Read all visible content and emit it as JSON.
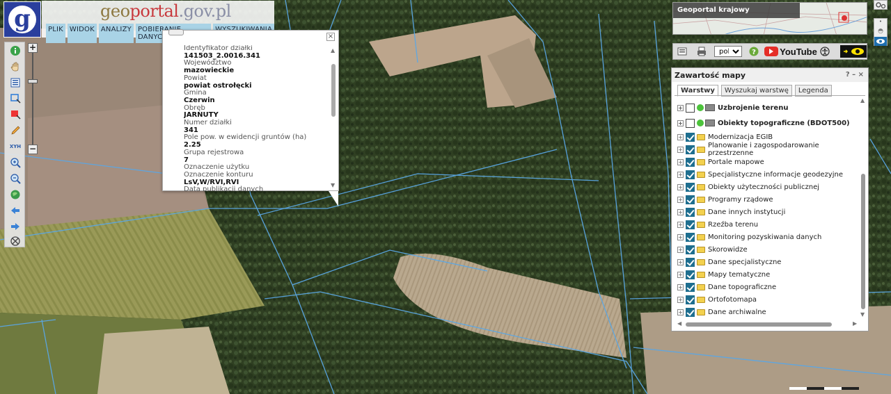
{
  "header": {
    "logo_letter": "g",
    "brand_geo": "geo",
    "brand_portal": "portal",
    "brand_domain": ".gov.pl",
    "menu": [
      "PLIK",
      "WIDOK",
      "ANALIZY",
      "POBIERANIE DANYCH",
      "WYSZUKIWANIA"
    ]
  },
  "toolbar": {
    "xyh_label": "XYH",
    "zoom_plus": "+",
    "zoom_minus": "−",
    "zoom_level_fraction": 0.7
  },
  "popup": {
    "fields": [
      {
        "label": "Identyfikator działki",
        "value": "141503_2.0016.341"
      },
      {
        "label": "Województwo",
        "value": "mazowieckie"
      },
      {
        "label": "Powiat",
        "value": "powiat ostrołęcki"
      },
      {
        "label": "Gmina",
        "value": "Czerwin"
      },
      {
        "label": "Obręb",
        "value": "JARNUTY"
      },
      {
        "label": "Numer działki",
        "value": "341"
      },
      {
        "label": "Pole pow. w ewidencji gruntów (ha)",
        "value": "2.25"
      },
      {
        "label": "Grupa rejestrowa",
        "value": "7"
      },
      {
        "label": "Oznaczenie użytku",
        "value": ""
      },
      {
        "label": "Oznaczenie konturu",
        "value": "LsV,W/RVI,RVI"
      },
      {
        "label": "Data publikacji danych",
        "value": ""
      }
    ],
    "close_glyph": "×"
  },
  "minimap": {
    "label": "Geoportal krajowy"
  },
  "right_bar": {
    "language": "pol",
    "language_options": [
      "pol"
    ],
    "youtube_label": "YouTube"
  },
  "panel": {
    "title": "Zawartość mapy",
    "controls": "? – ×",
    "tabs": [
      "Warstwy",
      "Wyszukaj warstwę",
      "Legenda"
    ],
    "active_tab": "Warstwy",
    "layers": [
      {
        "name": "Uzbrojenie terenu",
        "checked": false,
        "kind": "service"
      },
      {
        "name": "Obiekty topograficzne (BDOT500)",
        "checked": false,
        "kind": "service"
      },
      {
        "name": "Modernizacja EGIB",
        "checked": true,
        "kind": "folder"
      },
      {
        "name": "Planowanie i zagospodarowanie przestrzenne",
        "checked": true,
        "kind": "folder"
      },
      {
        "name": "Portale mapowe",
        "checked": true,
        "kind": "folder"
      },
      {
        "name": "Specjalistyczne informacje geodezyjne",
        "checked": true,
        "kind": "folder"
      },
      {
        "name": "Obiekty użyteczności publicznej",
        "checked": true,
        "kind": "folder"
      },
      {
        "name": "Programy rządowe",
        "checked": true,
        "kind": "folder"
      },
      {
        "name": "Dane innych instytucji",
        "checked": true,
        "kind": "folder"
      },
      {
        "name": "Rzeźba terenu",
        "checked": true,
        "kind": "folder"
      },
      {
        "name": "Monitoring pozyskiwania danych",
        "checked": true,
        "kind": "folder"
      },
      {
        "name": "Skorowidze",
        "checked": true,
        "kind": "folder"
      },
      {
        "name": "Dane specjalistyczne",
        "checked": true,
        "kind": "folder"
      },
      {
        "name": "Mapy tematyczne",
        "checked": true,
        "kind": "folder"
      },
      {
        "name": "Dane topograficzne",
        "checked": true,
        "kind": "folder"
      },
      {
        "name": "Ortofotomapa",
        "checked": true,
        "kind": "folder"
      },
      {
        "name": "Dane archiwalne",
        "checked": true,
        "kind": "folder"
      }
    ]
  },
  "colors": {
    "brand_blue": "#2a3f9d",
    "menu_bg": "#a9d3e6",
    "parcel_line": "#5aa7e6",
    "checkbox_on": "#1e6e8f"
  },
  "icons": [
    "info-icon",
    "hand-pan-icon",
    "list-icon",
    "select-rect-icon",
    "measure-icon",
    "pencil-icon",
    "xyh-icon",
    "zoom-in-icon",
    "zoom-out-icon",
    "globe-icon",
    "back-arrow-icon",
    "forward-arrow-icon",
    "clear-icon"
  ]
}
